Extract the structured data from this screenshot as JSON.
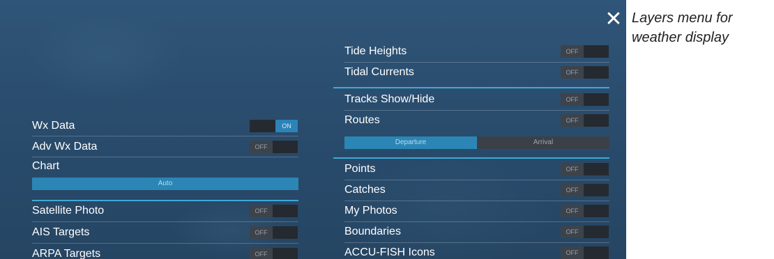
{
  "close": {
    "glyph": "✕"
  },
  "caption": {
    "line1": "Layers menu for",
    "line2": "weather display"
  },
  "left": {
    "wx_data": {
      "label": "Wx Data",
      "state": "ON"
    },
    "adv_wx_data": {
      "label": "Adv Wx Data",
      "state": "OFF"
    },
    "chart": {
      "label": "Chart",
      "option": "Auto"
    },
    "satellite_photo": {
      "label": "Satellite Photo",
      "state": "OFF"
    },
    "ais_targets": {
      "label": "AIS Targets",
      "state": "OFF"
    },
    "arpa_targets": {
      "label": "ARPA Targets",
      "state": "OFF"
    }
  },
  "right": {
    "tide_heights": {
      "label": "Tide Heights",
      "state": "OFF"
    },
    "tidal_currents": {
      "label": "Tidal Currents",
      "state": "OFF"
    },
    "tracks": {
      "label": "Tracks Show/Hide",
      "state": "OFF"
    },
    "routes": {
      "label": "Routes",
      "state": "OFF",
      "options": [
        "Departure",
        "Arrival"
      ],
      "selected": "Departure"
    },
    "points": {
      "label": "Points",
      "state": "OFF"
    },
    "catches": {
      "label": "Catches",
      "state": "OFF"
    },
    "my_photos": {
      "label": "My Photos",
      "state": "OFF"
    },
    "boundaries": {
      "label": "Boundaries",
      "state": "OFF"
    },
    "accu_fish": {
      "label": "ACCU-FISH Icons",
      "state": "OFF"
    }
  },
  "colors": {
    "accent": "#3fa9d6",
    "on": "#2c83b8",
    "panel": "#2a4d6e"
  }
}
